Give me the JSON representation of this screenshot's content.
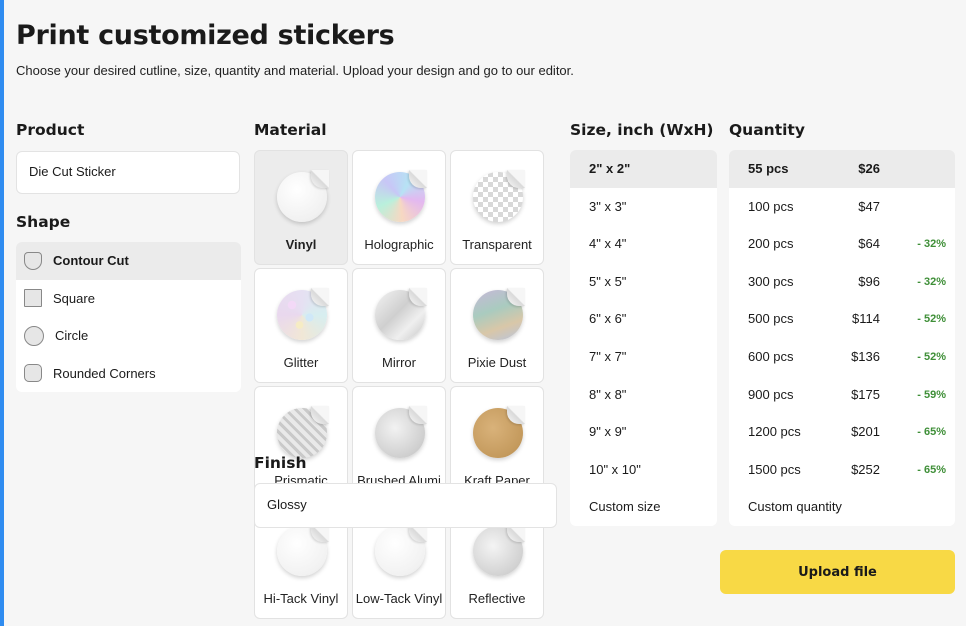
{
  "page": {
    "title": "Print customized stickers",
    "subtitle": "Choose your desired cutline, size, quantity and material. Upload your design and go to our editor."
  },
  "product": {
    "heading": "Product",
    "value": "Die Cut Sticker"
  },
  "shape": {
    "heading": "Shape",
    "items": [
      {
        "label": "Contour Cut",
        "icon": "contour-cut-icon",
        "selected": true
      },
      {
        "label": "Square",
        "icon": "square-icon",
        "selected": false
      },
      {
        "label": "Circle",
        "icon": "circle-icon",
        "selected": false
      },
      {
        "label": "Rounded Corners",
        "icon": "rounded-corners-icon",
        "selected": false
      }
    ]
  },
  "material": {
    "heading": "Material",
    "items": [
      {
        "label": "Vinyl",
        "selected": true
      },
      {
        "label": "Holographic",
        "selected": false
      },
      {
        "label": "Transparent",
        "selected": false
      },
      {
        "label": "Glitter",
        "selected": false
      },
      {
        "label": "Mirror",
        "selected": false
      },
      {
        "label": "Pixie Dust",
        "selected": false
      },
      {
        "label": "Prismatic",
        "selected": false
      },
      {
        "label": "Brushed Alumi",
        "selected": false
      },
      {
        "label": "Kraft Paper",
        "selected": false
      },
      {
        "label": "Hi-Tack Vinyl",
        "selected": false
      },
      {
        "label": "Low-Tack Vinyl",
        "selected": false
      },
      {
        "label": "Reflective",
        "selected": false
      }
    ]
  },
  "finish": {
    "heading": "Finish",
    "value": "Glossy"
  },
  "size": {
    "heading": "Size, inch (WxH)",
    "items": [
      {
        "label": "2\" x 2\"",
        "selected": true
      },
      {
        "label": "3\" x 3\""
      },
      {
        "label": "4\" x 4\""
      },
      {
        "label": "5\" x 5\""
      },
      {
        "label": "6\" x 6\""
      },
      {
        "label": "7\" x 7\""
      },
      {
        "label": "8\" x 8\""
      },
      {
        "label": "9\" x 9\""
      },
      {
        "label": "10\" x 10\""
      },
      {
        "label": "Custom size"
      }
    ]
  },
  "quantity": {
    "heading": "Quantity",
    "items": [
      {
        "pcs": "55 pcs",
        "price": "$26",
        "discount": "",
        "selected": true
      },
      {
        "pcs": "100 pcs",
        "price": "$47",
        "discount": ""
      },
      {
        "pcs": "200 pcs",
        "price": "$64",
        "discount": "- 32%"
      },
      {
        "pcs": "300 pcs",
        "price": "$96",
        "discount": "- 32%"
      },
      {
        "pcs": "500 pcs",
        "price": "$114",
        "discount": "- 52%"
      },
      {
        "pcs": "600 pcs",
        "price": "$136",
        "discount": "- 52%"
      },
      {
        "pcs": "900 pcs",
        "price": "$175",
        "discount": "- 59%"
      },
      {
        "pcs": "1200 pcs",
        "price": "$201",
        "discount": "- 65%"
      },
      {
        "pcs": "1500 pcs",
        "price": "$252",
        "discount": "- 65%"
      },
      {
        "pcs": "Custom quantity",
        "price": "",
        "discount": ""
      }
    ]
  },
  "upload": {
    "label": "Upload file"
  },
  "colors": {
    "accent": "#f8d945",
    "discount": "#3f8f38",
    "left_bar": "#2f8cf0"
  }
}
